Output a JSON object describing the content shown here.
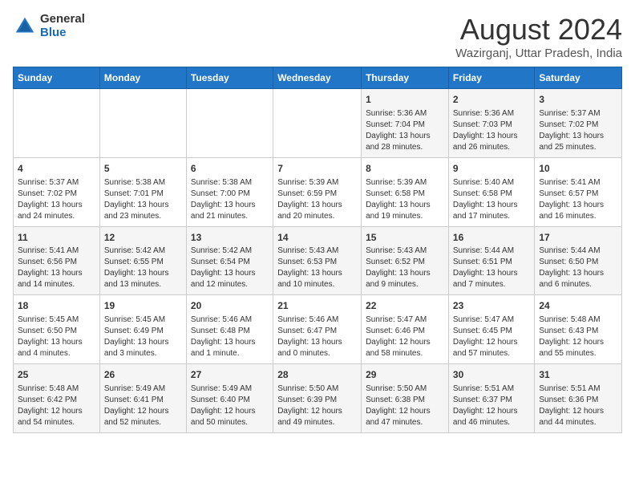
{
  "logo": {
    "general": "General",
    "blue": "Blue"
  },
  "header": {
    "month": "August 2024",
    "location": "Wazirganj, Uttar Pradesh, India"
  },
  "weekdays": [
    "Sunday",
    "Monday",
    "Tuesday",
    "Wednesday",
    "Thursday",
    "Friday",
    "Saturday"
  ],
  "weeks": [
    [
      {
        "day": "",
        "info": ""
      },
      {
        "day": "",
        "info": ""
      },
      {
        "day": "",
        "info": ""
      },
      {
        "day": "",
        "info": ""
      },
      {
        "day": "1",
        "info": "Sunrise: 5:36 AM\nSunset: 7:04 PM\nDaylight: 13 hours\nand 28 minutes."
      },
      {
        "day": "2",
        "info": "Sunrise: 5:36 AM\nSunset: 7:03 PM\nDaylight: 13 hours\nand 26 minutes."
      },
      {
        "day": "3",
        "info": "Sunrise: 5:37 AM\nSunset: 7:02 PM\nDaylight: 13 hours\nand 25 minutes."
      }
    ],
    [
      {
        "day": "4",
        "info": "Sunrise: 5:37 AM\nSunset: 7:02 PM\nDaylight: 13 hours\nand 24 minutes."
      },
      {
        "day": "5",
        "info": "Sunrise: 5:38 AM\nSunset: 7:01 PM\nDaylight: 13 hours\nand 23 minutes."
      },
      {
        "day": "6",
        "info": "Sunrise: 5:38 AM\nSunset: 7:00 PM\nDaylight: 13 hours\nand 21 minutes."
      },
      {
        "day": "7",
        "info": "Sunrise: 5:39 AM\nSunset: 6:59 PM\nDaylight: 13 hours\nand 20 minutes."
      },
      {
        "day": "8",
        "info": "Sunrise: 5:39 AM\nSunset: 6:58 PM\nDaylight: 13 hours\nand 19 minutes."
      },
      {
        "day": "9",
        "info": "Sunrise: 5:40 AM\nSunset: 6:58 PM\nDaylight: 13 hours\nand 17 minutes."
      },
      {
        "day": "10",
        "info": "Sunrise: 5:41 AM\nSunset: 6:57 PM\nDaylight: 13 hours\nand 16 minutes."
      }
    ],
    [
      {
        "day": "11",
        "info": "Sunrise: 5:41 AM\nSunset: 6:56 PM\nDaylight: 13 hours\nand 14 minutes."
      },
      {
        "day": "12",
        "info": "Sunrise: 5:42 AM\nSunset: 6:55 PM\nDaylight: 13 hours\nand 13 minutes."
      },
      {
        "day": "13",
        "info": "Sunrise: 5:42 AM\nSunset: 6:54 PM\nDaylight: 13 hours\nand 12 minutes."
      },
      {
        "day": "14",
        "info": "Sunrise: 5:43 AM\nSunset: 6:53 PM\nDaylight: 13 hours\nand 10 minutes."
      },
      {
        "day": "15",
        "info": "Sunrise: 5:43 AM\nSunset: 6:52 PM\nDaylight: 13 hours\nand 9 minutes."
      },
      {
        "day": "16",
        "info": "Sunrise: 5:44 AM\nSunset: 6:51 PM\nDaylight: 13 hours\nand 7 minutes."
      },
      {
        "day": "17",
        "info": "Sunrise: 5:44 AM\nSunset: 6:50 PM\nDaylight: 13 hours\nand 6 minutes."
      }
    ],
    [
      {
        "day": "18",
        "info": "Sunrise: 5:45 AM\nSunset: 6:50 PM\nDaylight: 13 hours\nand 4 minutes."
      },
      {
        "day": "19",
        "info": "Sunrise: 5:45 AM\nSunset: 6:49 PM\nDaylight: 13 hours\nand 3 minutes."
      },
      {
        "day": "20",
        "info": "Sunrise: 5:46 AM\nSunset: 6:48 PM\nDaylight: 13 hours\nand 1 minute."
      },
      {
        "day": "21",
        "info": "Sunrise: 5:46 AM\nSunset: 6:47 PM\nDaylight: 13 hours\nand 0 minutes."
      },
      {
        "day": "22",
        "info": "Sunrise: 5:47 AM\nSunset: 6:46 PM\nDaylight: 12 hours\nand 58 minutes."
      },
      {
        "day": "23",
        "info": "Sunrise: 5:47 AM\nSunset: 6:45 PM\nDaylight: 12 hours\nand 57 minutes."
      },
      {
        "day": "24",
        "info": "Sunrise: 5:48 AM\nSunset: 6:43 PM\nDaylight: 12 hours\nand 55 minutes."
      }
    ],
    [
      {
        "day": "25",
        "info": "Sunrise: 5:48 AM\nSunset: 6:42 PM\nDaylight: 12 hours\nand 54 minutes."
      },
      {
        "day": "26",
        "info": "Sunrise: 5:49 AM\nSunset: 6:41 PM\nDaylight: 12 hours\nand 52 minutes."
      },
      {
        "day": "27",
        "info": "Sunrise: 5:49 AM\nSunset: 6:40 PM\nDaylight: 12 hours\nand 50 minutes."
      },
      {
        "day": "28",
        "info": "Sunrise: 5:50 AM\nSunset: 6:39 PM\nDaylight: 12 hours\nand 49 minutes."
      },
      {
        "day": "29",
        "info": "Sunrise: 5:50 AM\nSunset: 6:38 PM\nDaylight: 12 hours\nand 47 minutes."
      },
      {
        "day": "30",
        "info": "Sunrise: 5:51 AM\nSunset: 6:37 PM\nDaylight: 12 hours\nand 46 minutes."
      },
      {
        "day": "31",
        "info": "Sunrise: 5:51 AM\nSunset: 6:36 PM\nDaylight: 12 hours\nand 44 minutes."
      }
    ]
  ]
}
